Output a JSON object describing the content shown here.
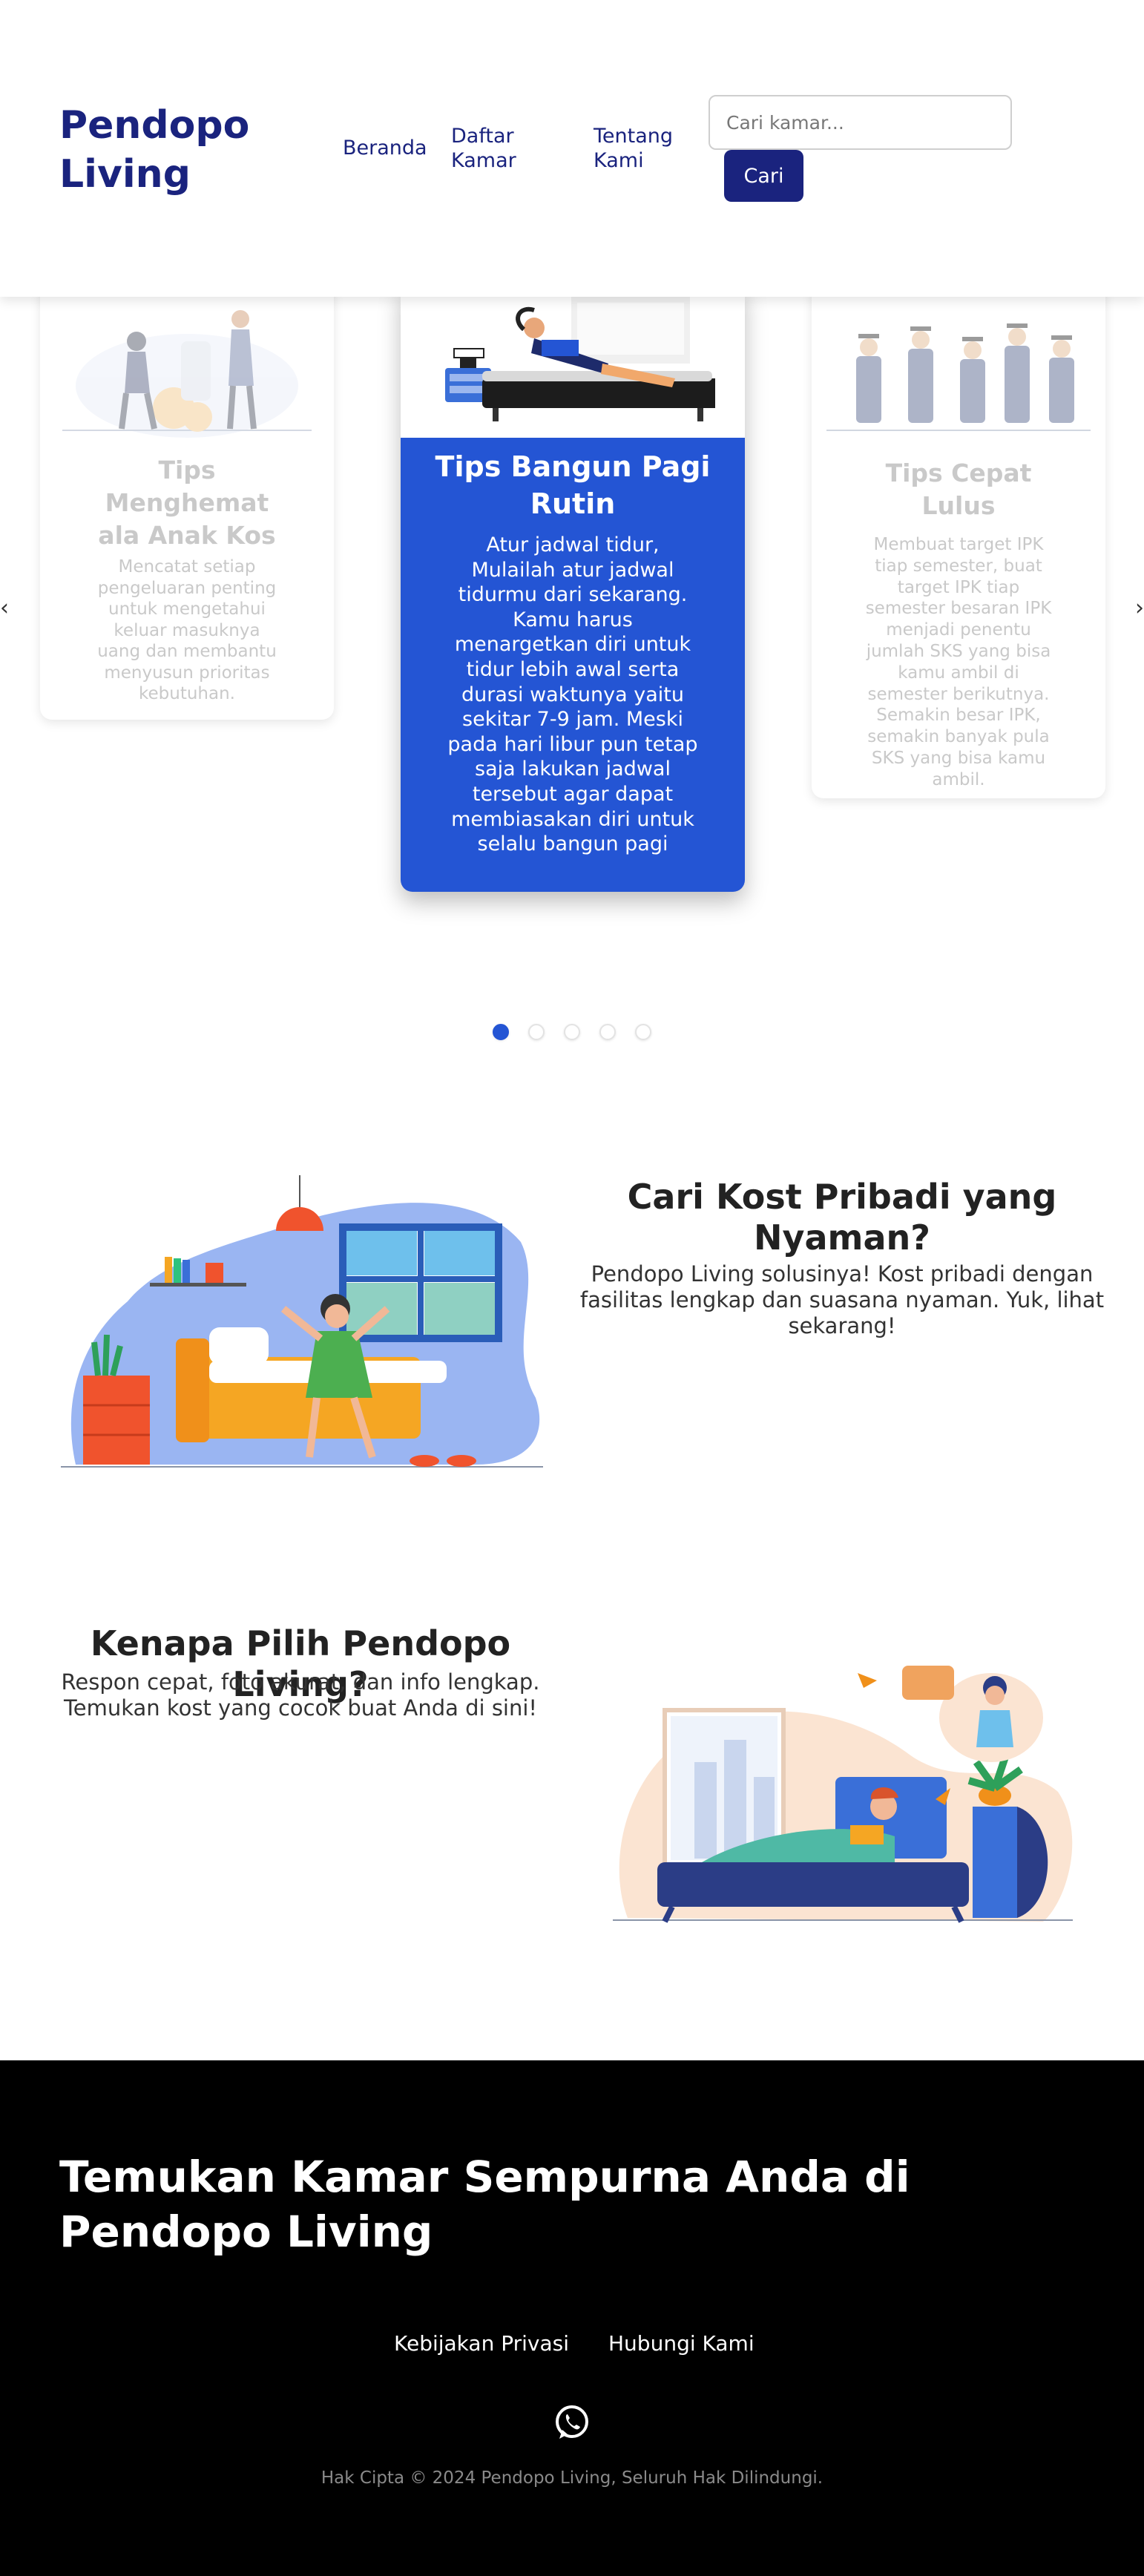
{
  "header": {
    "brand": "Pendopo Living",
    "nav": [
      "Beranda",
      "Daftar Kamar",
      "Tentang Kami"
    ],
    "search": {
      "placeholder": "Cari kamar...",
      "button_label": "Cari"
    }
  },
  "carousel": {
    "prev_label": "‹",
    "next_label": "›",
    "cards": [
      {
        "title": "Tips Menghemat ala Anak Kos",
        "text": "Mencatat setiap pengeluaran penting untuk mengetahui keluar masuknya uang dan membantu menyusun prioritas kebutuhan."
      },
      {
        "title": "Tips Bangun Pagi Rutin",
        "text": "Atur jadwal tidur, Mulailah atur jadwal tidurmu dari sekarang. Kamu harus menargetkan diri untuk tidur lebih awal serta durasi waktunya yaitu sekitar 7-9 jam. Meski pada hari libur pun tetap saja lakukan jadwal tersebut agar dapat membiasakan diri untuk selalu bangun pagi"
      },
      {
        "title": "Tips Cepat Lulus",
        "text": "Membuat target IPK tiap semester, buat target IPK tiap semester besaran IPK menjadi penentu jumlah SKS yang bisa kamu ambil di semester berikutnya. Semakin besar IPK, semakin banyak pula SKS yang bisa kamu ambil."
      }
    ],
    "dot_count": 5,
    "active_dot": 1
  },
  "section1": {
    "title": "Cari Kost Pribadi yang Nyaman?",
    "text": "Pendopo Living solusinya! Kost pribadi dengan fasilitas lengkap dan suasana nyaman. Yuk, lihat sekarang!"
  },
  "section2": {
    "title": "Kenapa Pilih Pendopo Living?",
    "text": "Respon cepat, foto akurat, dan info lengkap. Temukan kost yang cocok buat Anda di sini!"
  },
  "footer": {
    "title": "Temukan Kamar Sempurna Anda di Pendopo Living",
    "links": [
      "Kebijakan Privasi",
      "Hubungi Kami"
    ],
    "copyright": "Hak Cipta © 2024 Pendopo Living, Seluruh Hak Dilindungi."
  },
  "colors": {
    "brand": "#1a237e",
    "accent": "#2455d4",
    "footer_bg": "#000000"
  },
  "icons": [
    "whatsapp-icon",
    "chevron-left-icon",
    "chevron-right-icon"
  ]
}
